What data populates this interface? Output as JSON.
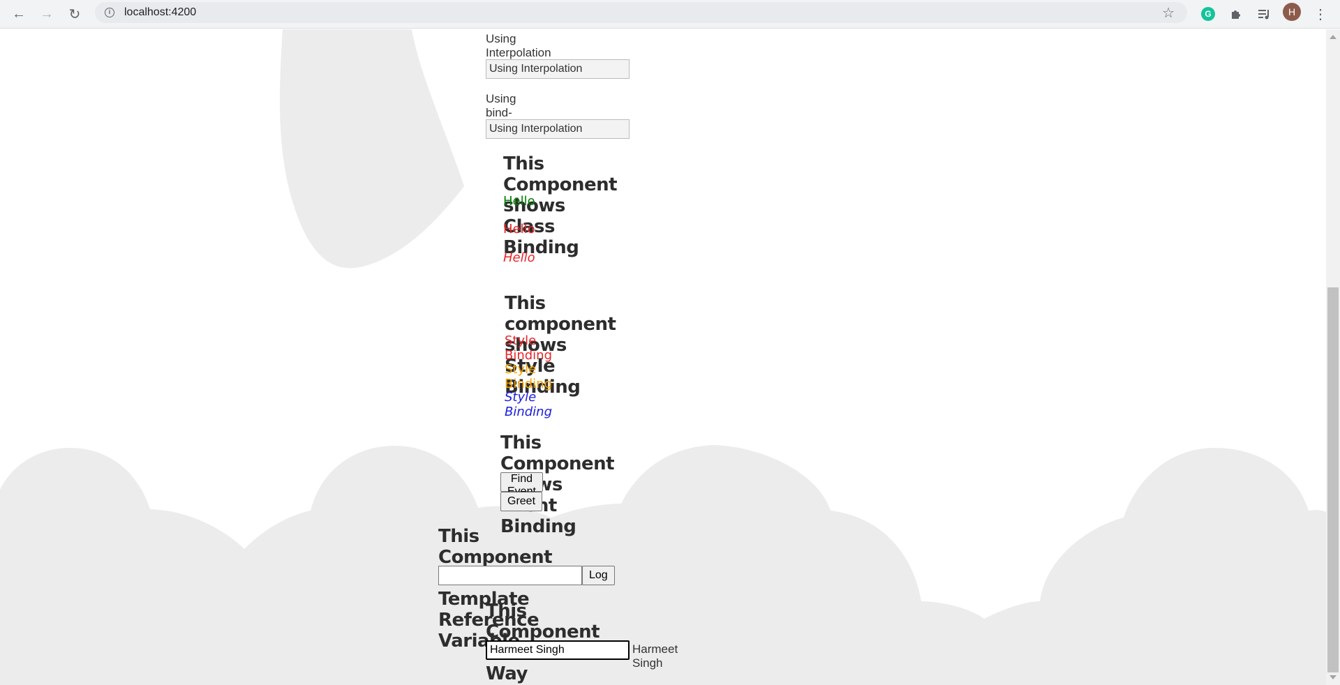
{
  "browser": {
    "url": "localhost:4200",
    "avatar_initial": "H",
    "grammarly_letter": "G"
  },
  "interpolation": {
    "label1": "Using Interpolation",
    "input1_value": "Using Interpolation",
    "label2": "Using bind- Syntax",
    "input2_value": "Using Interpolation"
  },
  "class_binding": {
    "heading": "This Component shows Class Binding",
    "items": [
      {
        "text": "Hello",
        "color": "#008000"
      },
      {
        "text": "Hello",
        "color": "#e8252a"
      },
      {
        "text": "Hello",
        "color": "#e8252a"
      }
    ]
  },
  "style_binding": {
    "heading": "This component shows Style Binding",
    "items": [
      {
        "text": "Style Binding",
        "color": "#e8252a"
      },
      {
        "text": "Style Binding",
        "color": "#f5a300"
      },
      {
        "text": "Style Binding",
        "color": "#1d1de0"
      }
    ]
  },
  "event_binding": {
    "heading": "This Component shows Event Binding",
    "find_button": "Find Event Type",
    "greet_button": "Greet"
  },
  "template_ref": {
    "heading": "This Component shows Template Reference Variable",
    "input_value": "",
    "log_button": "Log"
  },
  "two_way": {
    "heading": "This Component shows Two Way Binding",
    "input_value": "Harmeet Singh",
    "output_text": "Harmeet Singh"
  },
  "colors": {
    "cloud": "#ececec",
    "heading": "#2d2d2d"
  }
}
